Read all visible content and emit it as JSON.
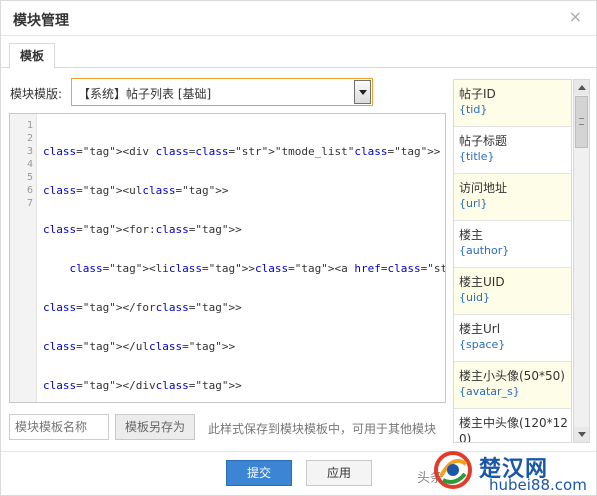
{
  "dialog": {
    "title": "模块管理",
    "close_glyph": "×"
  },
  "tabs": [
    {
      "label": "模板"
    }
  ],
  "template": {
    "label": "模块模版:",
    "selected": "【系统】帖子列表 [基础]"
  },
  "editor": {
    "line_numbers": [
      "1",
      "2",
      "3",
      "4",
      "5",
      "6",
      "7"
    ],
    "lines": [
      "<div class=\"tmode_list\">",
      "<ul>",
      "<for:>",
      "    <li><a href=\"{url}\" target=\"_blank\">{title}</a></li>",
      "</for>",
      "</ul>",
      "</div>"
    ]
  },
  "variables": [
    {
      "name": "帖子ID",
      "code": "{tid}"
    },
    {
      "name": "帖子标题",
      "code": "{title}"
    },
    {
      "name": "访问地址",
      "code": "{url}"
    },
    {
      "name": "楼主",
      "code": "{author}"
    },
    {
      "name": "楼主UID",
      "code": "{uid}"
    },
    {
      "name": "楼主Url",
      "code": "{space}"
    },
    {
      "name": "楼主小头像(50*50)",
      "code": "{avatar_s}"
    },
    {
      "name": "楼主中头像(120*120)",
      "code": ""
    }
  ],
  "save": {
    "name_placeholder": "模块模板名称",
    "save_as_label": "模板另存为",
    "hint": "此样式保存到模块模板中，可用于其他模块"
  },
  "footer": {
    "submit_label": "提交",
    "apply_label": "应用"
  },
  "watermark": {
    "prefix": "头条",
    "brand": "楚汉网",
    "site": "hubei88.com"
  },
  "colors": {
    "primary_button": "#3b85d4",
    "select_border": "#f0a030",
    "variable_code": "#2a6dbd",
    "alt_row": "#fefde8"
  }
}
